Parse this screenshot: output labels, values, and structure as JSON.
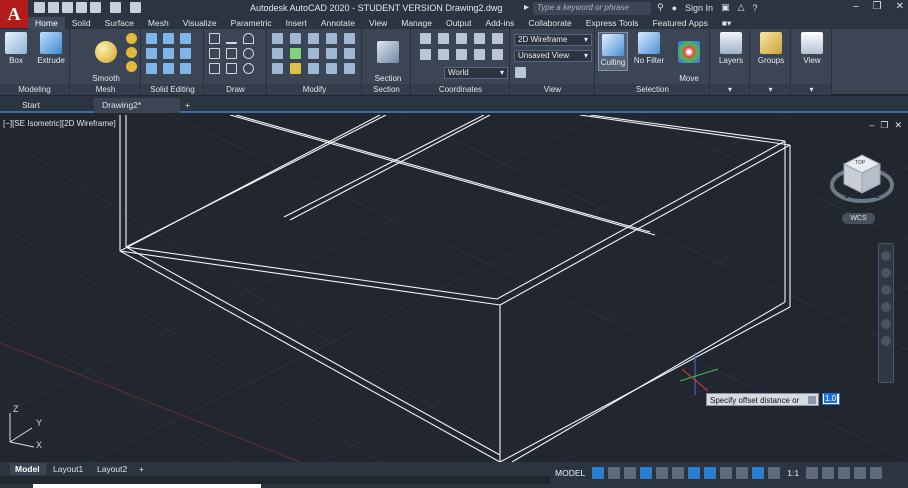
{
  "app": {
    "logo_letter": "A",
    "window_title": "Autodesk AutoCAD 2020 - STUDENT VERSION    Drawing2.dwg",
    "search_placeholder": "Type a keyword or phrase",
    "sign_in": "Sign In",
    "help": "?"
  },
  "ribbon_tabs": [
    "Home",
    "Solid",
    "Surface",
    "Mesh",
    "Visualize",
    "Parametric",
    "Insert",
    "Annotate",
    "View",
    "Manage",
    "Output",
    "Add-ins",
    "Collaborate",
    "Express Tools",
    "Featured Apps"
  ],
  "ribbon": {
    "modeling_label": "Modeling",
    "box_label": "Box",
    "extrude_label": "Extrude",
    "smooth_label": "Smooth\nObject",
    "mesh_label": "Mesh",
    "solid_editing_label": "Solid Editing",
    "draw_label": "Draw",
    "modify_label": "Modify",
    "section_plane_label": "Section\nPlane",
    "section_label": "Section",
    "coordinates_label": "Coordinates",
    "visual_style_value": "2D Wireframe",
    "saved_view_value": "Unsaved View",
    "ucs_value": "World",
    "view_label": "View",
    "culling_label": "Culling",
    "no_filter_label": "No Filter",
    "move_gizmo_label": "Move\nGizmo",
    "selection_label": "Selection",
    "layers_label": "Layers",
    "groups_label": "Groups",
    "view_btn_label": "View"
  },
  "doc_tabs": {
    "start": "Start",
    "drawing": "Drawing2*",
    "add": "+"
  },
  "viewport": {
    "label": "[−][SE Isometric][2D Wireframe]",
    "viewcube_top": "TOP",
    "viewcube_s": "S",
    "viewcube_e": "E",
    "wcs": "WCS",
    "axis_x": "X",
    "axis_y": "Y",
    "axis_z": "Z"
  },
  "command": {
    "prompt": "Specify offset distance or",
    "input_value": "1.0"
  },
  "layout_tabs": [
    "Model",
    "Layout1",
    "Layout2"
  ],
  "layout_add": "+",
  "status": {
    "model": "MODEL",
    "scale": "1:1"
  },
  "colors": {
    "background": "#21262f",
    "ribbon": "#3b4554",
    "accent": "#2a7fd4"
  }
}
